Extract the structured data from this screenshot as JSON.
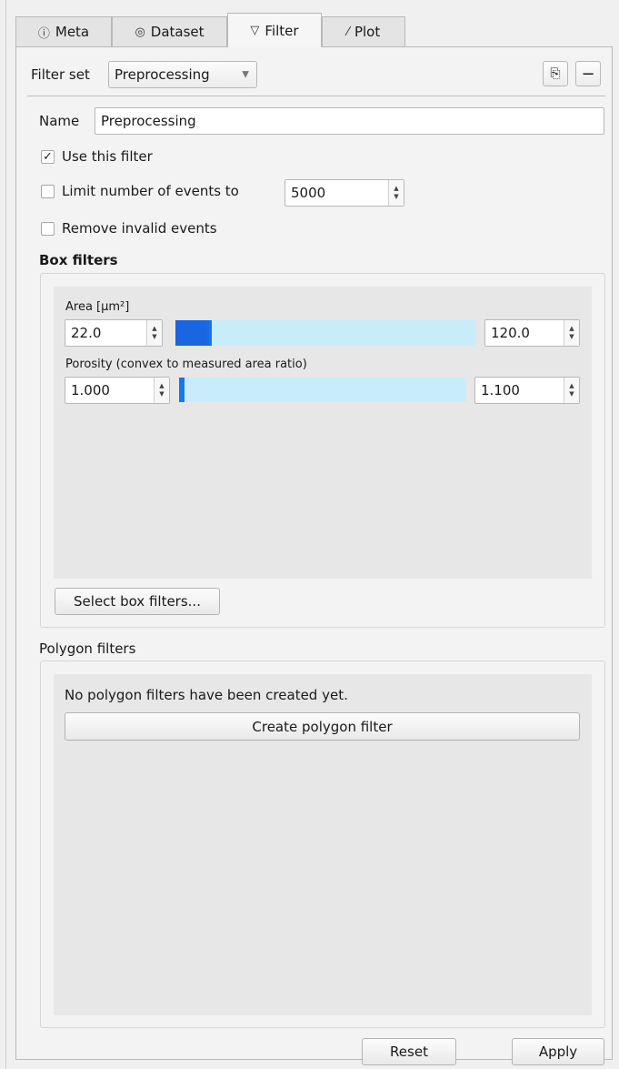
{
  "tabs": [
    {
      "label": "Meta",
      "icon": "info-icon",
      "glyph": "ⓘ"
    },
    {
      "label": "Dataset",
      "icon": "dataset-icon",
      "glyph": "◎"
    },
    {
      "label": "Filter",
      "icon": "filter-icon",
      "glyph": "▽"
    },
    {
      "label": "Plot",
      "icon": "plot-icon",
      "glyph": "⁄"
    }
  ],
  "active_tab": "Filter",
  "filter_set": {
    "label": "Filter set",
    "selected": "Preprocessing",
    "duplicate_glyph": "⎘",
    "remove_glyph": "−"
  },
  "name": {
    "label": "Name",
    "value": "Preprocessing"
  },
  "use_filter": {
    "label": "Use this filter",
    "checked": true,
    "glyph": "✓"
  },
  "limit_events": {
    "label": "Limit number of events to",
    "checked": false,
    "value": "5000"
  },
  "remove_invalid": {
    "label": "Remove invalid events",
    "checked": false
  },
  "box_filters": {
    "title": "Box filters",
    "items": [
      {
        "label": "Area [µm²]",
        "min": "22.0",
        "max": "120.0",
        "range_start": 0.0,
        "range_end": 0.12
      },
      {
        "label": "Porosity (convex to measured area ratio)",
        "min": "1.000",
        "max": "1.100",
        "range_start": 0.0,
        "range_end": 0.02
      }
    ],
    "select_button": "Select box filters..."
  },
  "polygon_filters": {
    "title": "Polygon filters",
    "empty_text": "No polygon filters have been created yet.",
    "create_button": "Create polygon filter"
  },
  "actions": {
    "reset": "Reset",
    "apply": "Apply"
  },
  "colors": {
    "accent": "#1677ee",
    "track": "#c9ecfb"
  }
}
